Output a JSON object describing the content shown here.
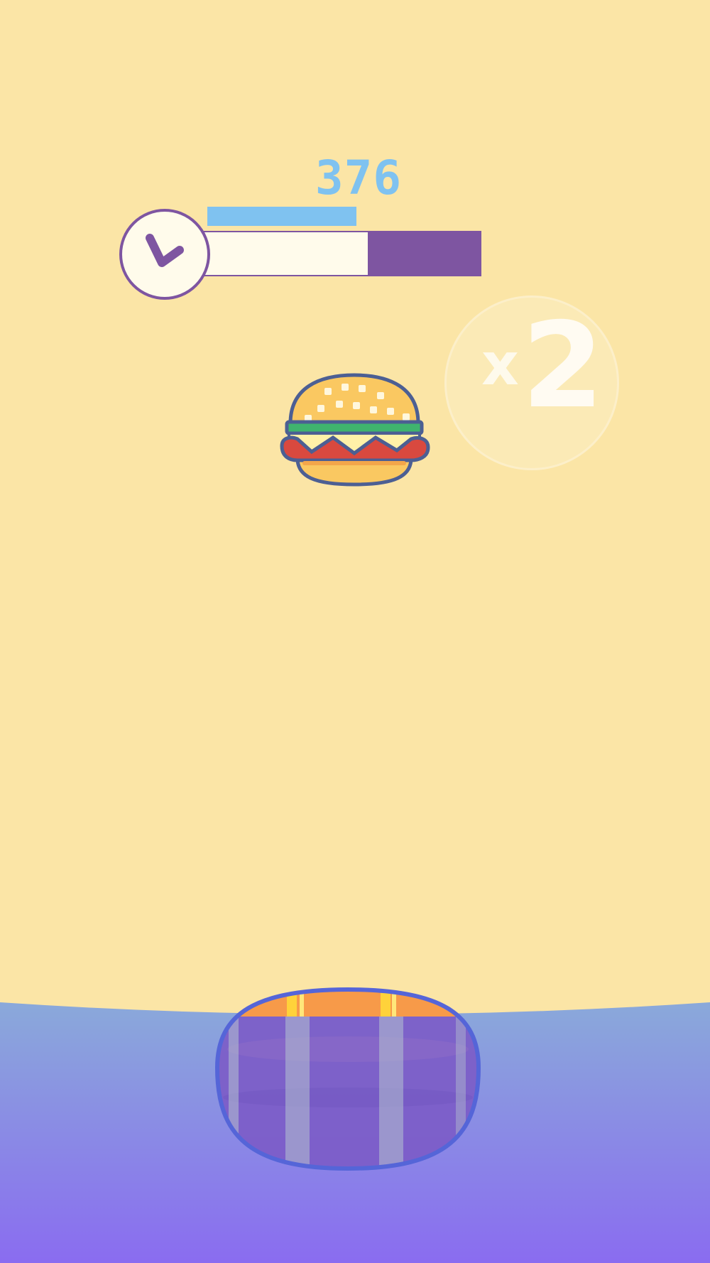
{
  "hud": {
    "score": "376",
    "score_progress": 0.5,
    "timer_remaining_fraction": 0.6,
    "timer_icon": "clock-icon"
  },
  "powerup": {
    "prefix": "x",
    "multiplier": "2"
  },
  "falling_item": {
    "icon": "burger-icon"
  },
  "catcher": {
    "icon": "basket-icon"
  },
  "colors": {
    "background": "#fbe5a6",
    "score": "#7fc2f0",
    "timer_track": "#7e55a1",
    "timer_fill": "#fffbeb",
    "water_top": "#8aa9da",
    "water_bottom": "#8a6cf0",
    "basket_rim": "#f79a49",
    "basket_body": "#7b5bc6",
    "basket_outline": "#5565d8"
  }
}
